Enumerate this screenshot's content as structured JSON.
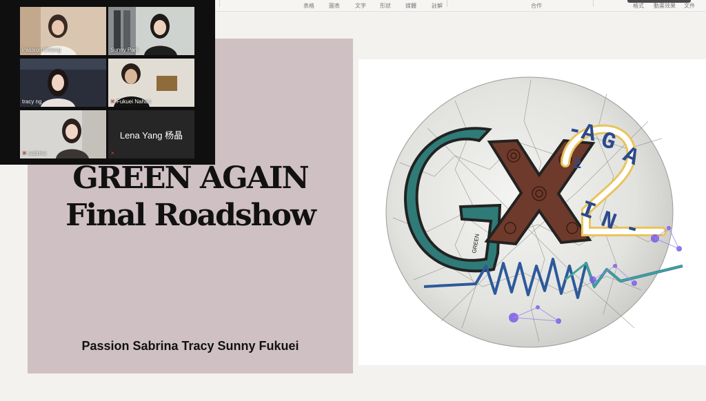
{
  "toolbar": {
    "items": [
      "表格",
      "圖表",
      "文字",
      "形狀",
      "媒體",
      "註解",
      "合作",
      "格式",
      "動畫效果",
      "文件"
    ]
  },
  "slide": {
    "title_line1": "GREEN AGAIN",
    "title_line2": "Final Roadshow",
    "names": "Passion Sabrina Tracy Sunny Fukuei"
  },
  "logo": {
    "letters_main": "GX",
    "letters_side": "-AGAIN-",
    "digit": "2",
    "small_text": "GREEN",
    "colors": {
      "teal": "#2f7b78",
      "brown": "#6e3a2c",
      "blue": "#2c4a8c",
      "yellow": "#e8c45a",
      "purple": "#7b5ce6"
    }
  },
  "participants": [
    {
      "name": "Passion Chiang",
      "muted": false,
      "active": false,
      "video": true
    },
    {
      "name": "Sunny Park",
      "muted": false,
      "active": true,
      "video": true
    },
    {
      "name": "tracy ng",
      "muted": false,
      "active": false,
      "video": true
    },
    {
      "name": "Fukuei Nahari",
      "muted": true,
      "active": false,
      "video": true
    },
    {
      "name": "sabrina",
      "muted": true,
      "active": false,
      "video": true
    },
    {
      "name": "Lena Yang 杨晶",
      "muted": true,
      "active": false,
      "video": false
    }
  ]
}
